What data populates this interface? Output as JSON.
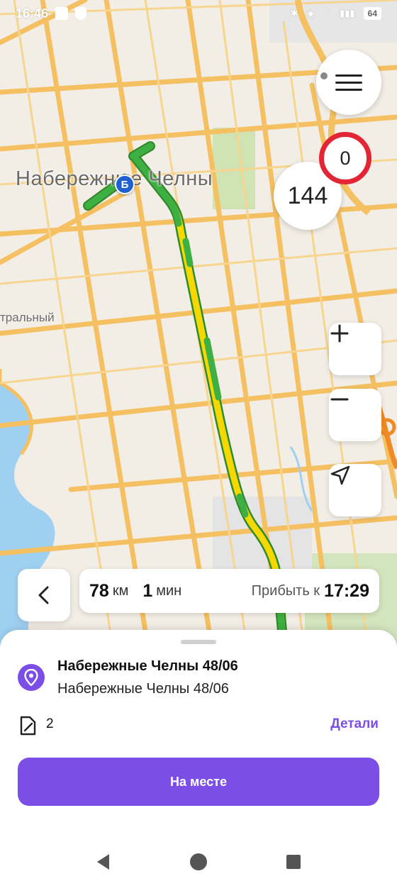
{
  "status_bar": {
    "time": "16:46",
    "battery": "64"
  },
  "map": {
    "city_label": "Набережные Челны",
    "district_label": "тральный",
    "marker_label": "Б",
    "speed_limit": "0",
    "current_speed": "144",
    "icons": [
      "menu-icon",
      "plus-icon",
      "minus-icon",
      "locate-arrow-icon"
    ],
    "route_colors": [
      "#3cb043",
      "#f5d800"
    ]
  },
  "route": {
    "distance_value": "78",
    "distance_unit": "км",
    "duration_value": "1",
    "duration_unit": "мин",
    "arrive_label": "Прибыть к",
    "arrive_time": "17:29"
  },
  "sheet": {
    "destination_title": "Набережные Челны 48/06",
    "destination_subtitle": "Набережные Челны 48/06",
    "documents_count": "2",
    "details_label": "Детали",
    "arrived_button": "На месте"
  },
  "colors": {
    "accent": "#7b4ee8",
    "speed_limit_ring": "#e32636"
  }
}
